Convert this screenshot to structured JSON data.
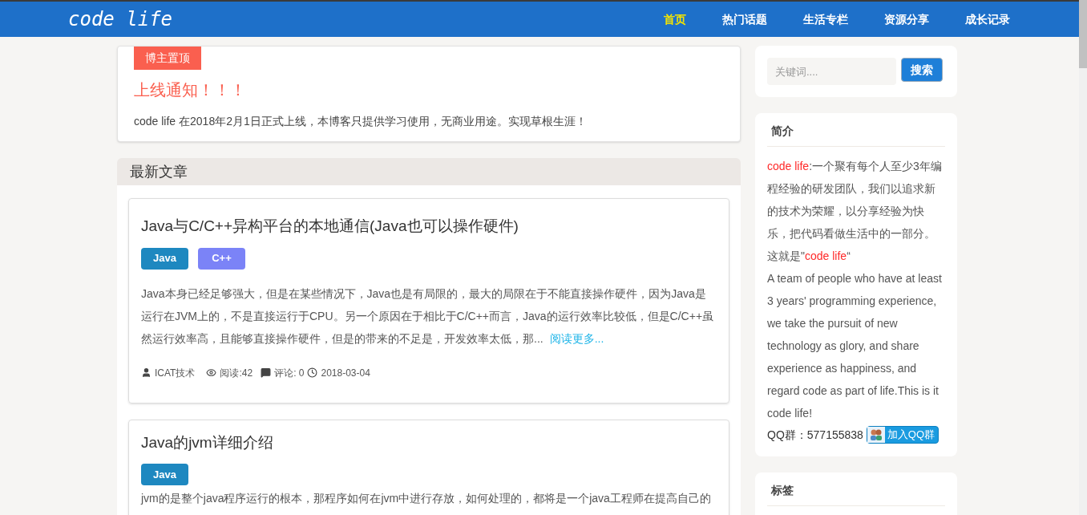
{
  "header": {
    "logo": "code life",
    "nav": [
      {
        "label": "首页",
        "selected": true
      },
      {
        "label": "热门话题",
        "selected": false
      },
      {
        "label": "生活专栏",
        "selected": false
      },
      {
        "label": "资源分享",
        "selected": false
      },
      {
        "label": "成长记录",
        "selected": false
      }
    ]
  },
  "pinned": {
    "badge": "博主置顶",
    "title": "上线通知！！！",
    "text": "code life 在2018年2月1日正式上线，本博客只提供学习使用，无商业用途。实现草根生涯！"
  },
  "latest": {
    "heading": "最新文章",
    "articles": [
      {
        "title": "Java与C/C++异构平台的本地通信(Java也可以操作硬件)",
        "tags": [
          {
            "label": "Java",
            "color": "#1e88c0"
          },
          {
            "label": "C++",
            "color": "#7b83f7"
          }
        ],
        "excerpt": "Java本身已经足够强大，但是在某些情况下，Java也是有局限的，最大的局限在于不能直接操作硬件，因为Java是运行在JVM上的，不是直接运行于CPU。另一个原因在于相比于C/C++而言，Java的运行效率比较低，但是C/C++虽然运行效率高，且能够直接操作硬件，但是的带来的不足是，开发效率太低，那...",
        "read_more": "阅读更多...",
        "author": "ICAT技术",
        "views": "阅读:42",
        "comments": "评论: 0",
        "date": "2018-03-04"
      },
      {
        "title": "Java的jvm详细介绍",
        "tags": [
          {
            "label": "Java",
            "color": "#1e88c0"
          }
        ],
        "excerpt": "jvm的是整个java程序运行的根本，那程序如何在jvm中进行存放，如何处理的，都将是一个java工程师在提高自己的"
      }
    ]
  },
  "sidebar": {
    "search": {
      "placeholder": "关键词....",
      "button": "搜索"
    },
    "intro": {
      "heading": "简介",
      "segments": [
        {
          "text": "code life",
          "highlight": true
        },
        {
          "text": ":一个聚有每个人至少3年编程经验的研发团队，我们以追求新的技术为荣耀，以分享经验为快乐，把代码看做生活中的一部分。这就是\"",
          "highlight": false
        },
        {
          "text": "code life",
          "highlight": true
        },
        {
          "text": "“",
          "highlight": false
        }
      ],
      "english": "A team of people who have at least 3 years' programming experience, we take the pursuit of new technology as glory, and share experience as happiness, and regard code as part of life.This is it code life!",
      "qq": "QQ群：577155838",
      "join": "加入QQ群"
    },
    "tags_heading": "标签"
  }
}
